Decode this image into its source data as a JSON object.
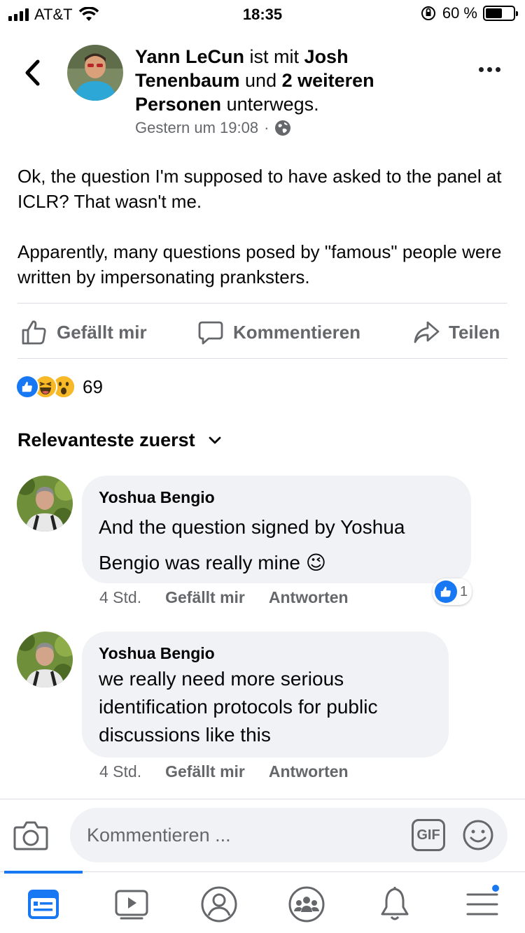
{
  "status_bar": {
    "carrier": "AT&T",
    "time": "18:35",
    "battery_percent": "60 %",
    "battery_level": 0.6
  },
  "post": {
    "author": "Yann LeCun",
    "header_connector_1": "ist mit",
    "tagged_person": "Josh Tenenbaum",
    "header_connector_2": "und",
    "others": "2 weiteren Personen",
    "header_suffix": "unterwegs.",
    "timestamp": "Gestern um 19:08",
    "separator": "·",
    "privacy_icon": "globe-icon",
    "body_paragraphs": [
      "Ok, the question I'm supposed to have asked to the panel at ICLR? That wasn't me.",
      "Apparently, many questions posed by \"famous\" people were written by impersonating pranksters."
    ]
  },
  "actions": {
    "like_label": "Gefällt mir",
    "comment_label": "Kommentieren",
    "share_label": "Teilen"
  },
  "reactions": {
    "types": [
      "like",
      "haha",
      "wow"
    ],
    "count": "69"
  },
  "sort": {
    "label": "Relevanteste zuerst"
  },
  "comments": [
    {
      "author": "Yoshua Bengio",
      "text": "And the question signed by Yoshua Bengio was really mine",
      "emoji": "😉",
      "time": "4 Std.",
      "like_label": "Gefällt mir",
      "reply_label": "Antworten",
      "like_count": "1"
    },
    {
      "author": "Yoshua Bengio",
      "text": "we really need more serious identification protocols for public discussions like this",
      "time": "4 Std.",
      "like_label": "Gefällt mir",
      "reply_label": "Antworten"
    }
  ],
  "compose": {
    "placeholder": "Kommentieren ...",
    "gif_label": "GIF"
  },
  "tabbar": {
    "tabs": [
      "news-feed-icon",
      "watch-icon",
      "profile-icon",
      "groups-icon",
      "notifications-icon",
      "menu-icon"
    ],
    "active": "news-feed-icon"
  },
  "colors": {
    "accent": "#1877f2",
    "secondary_text": "#65676b",
    "bubble": "#f0f2f5"
  }
}
